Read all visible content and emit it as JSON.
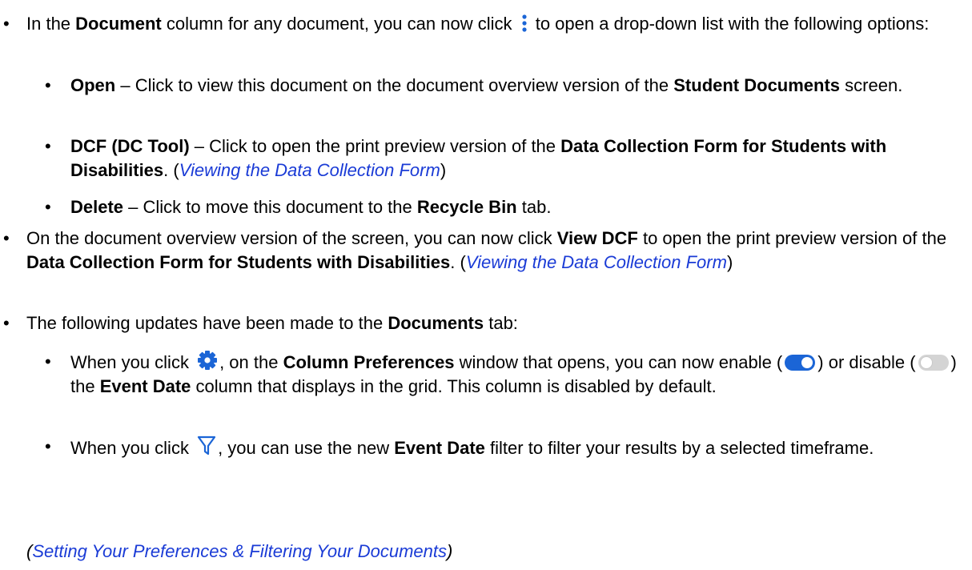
{
  "colors": {
    "text": "#000000",
    "link": "#1a3bd6",
    "icon_blue": "#1b65d6",
    "toggle_on": "#1b65d6",
    "toggle_off": "#cfcfcf"
  },
  "icons": {
    "kebab": "kebab-vertical-icon",
    "gear": "gear-icon",
    "filter": "filter-funnel-icon",
    "toggle_on": "toggle-on-icon",
    "toggle_off": "toggle-off-icon"
  },
  "b1": {
    "t1": "In the ",
    "b1": "Document",
    "t2": " column for any document, you can now click ",
    "t3": " to open a drop-down list with the following options:",
    "open": {
      "label": "Open",
      "t1": " – Click to view this document on the document overview version of the ",
      "b1": "Student Documents",
      "t2": " screen."
    },
    "dcf": {
      "label": "DCF (DC Tool)",
      "t1": " – Click to open the print preview version of the ",
      "b1": "Data Collection Form for Students with Disabilities",
      "t2": ". (",
      "link": "Viewing the Data Collection Form",
      "t3": ")"
    },
    "del": {
      "label": "Delete",
      "t1": " – Click to move this document to the ",
      "b1": "Recycle Bin",
      "t2": " tab."
    }
  },
  "b2": {
    "t1": "On the document overview version of the screen, you can now click ",
    "b1": "View DCF",
    "t2": " to open the print preview version of the ",
    "b2": "Data Collection Form for Students with Disabilities",
    "t3": ". (",
    "link": "Viewing the Data Collection Form",
    "t4": ")"
  },
  "b3": {
    "t1": "The following updates have been made to the ",
    "b1": "Documents",
    "t2": " tab:",
    "s1": {
      "t1": "When you click ",
      "t2": ", on the ",
      "b1": "Column Preferences",
      "t3": " window that opens, you can now enable (",
      "t4": ") or disable (",
      "t5": ") the ",
      "b2": "Event Date",
      "t6": " column that displays in the grid. This column is disabled by default."
    },
    "s2": {
      "t1": "When you click ",
      "t2": ", you can use the new ",
      "b1": "Event Date",
      "t3": " filter to filter your results by a selected timeframe."
    }
  },
  "footer": {
    "open": "(",
    "link": "Setting Your Preferences & Filtering Your Documents",
    "close": ")"
  }
}
